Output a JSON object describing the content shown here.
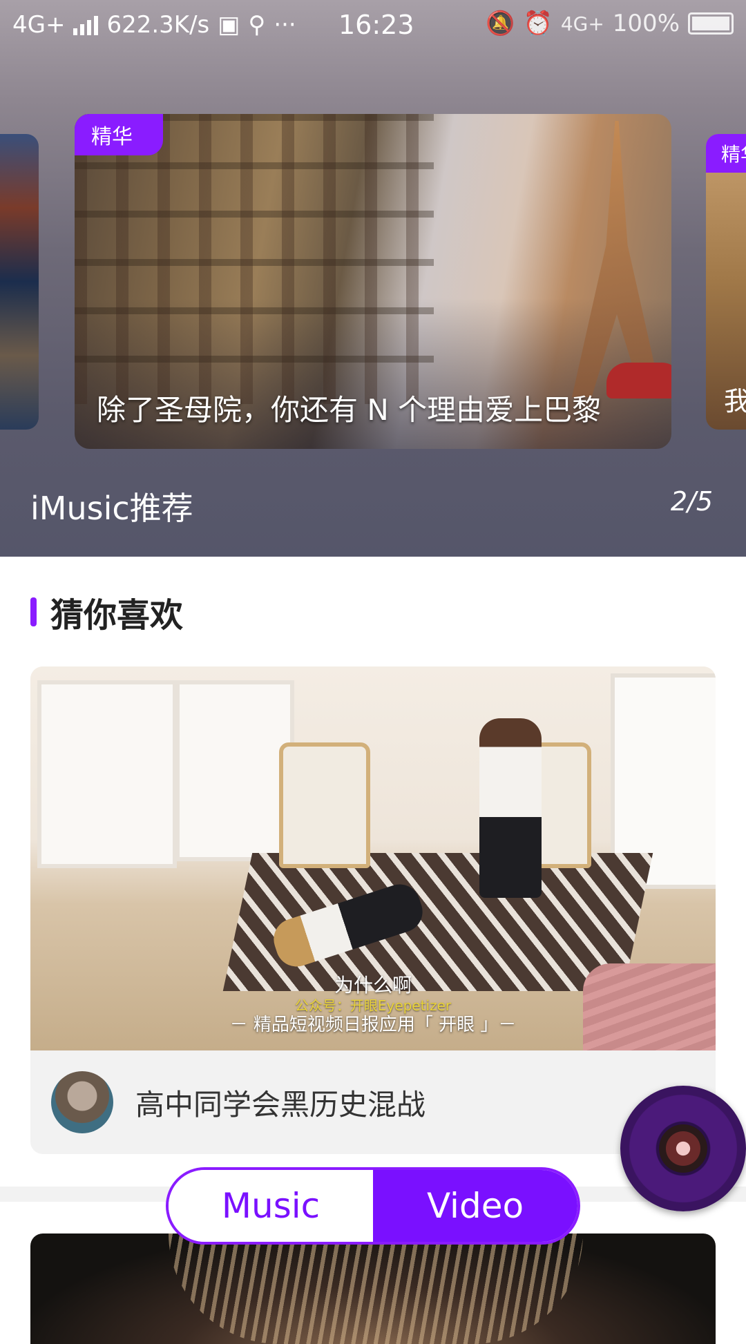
{
  "status_bar": {
    "network": "4G+",
    "speed": "622.3K/s",
    "more": "···",
    "time": "16:23",
    "network_right": "4G+",
    "battery": "100%"
  },
  "banner": {
    "cards": [
      {
        "tag": "",
        "caption": ""
      },
      {
        "tag": "精华",
        "caption": "除了圣母院，你还有 N 个理由爱上巴黎"
      },
      {
        "tag": "精华",
        "caption": "我"
      }
    ],
    "section_title": "iMusic推荐",
    "page_indicator": "2/5"
  },
  "recommend": {
    "title": "猜你喜欢",
    "video": {
      "subtitle_line1": "为什么啊",
      "subtitle_line2": "公众号：开眼Eyepetizer",
      "subtitle_line3": "－ 精品短视频日报应用「 开眼 」－",
      "title": "高中同学会黑历史混战"
    }
  },
  "toggle": {
    "music": "Music",
    "video": "Video",
    "active": "Video"
  },
  "colors": {
    "accent": "#7a10ff",
    "tag": "#8a1cff"
  }
}
